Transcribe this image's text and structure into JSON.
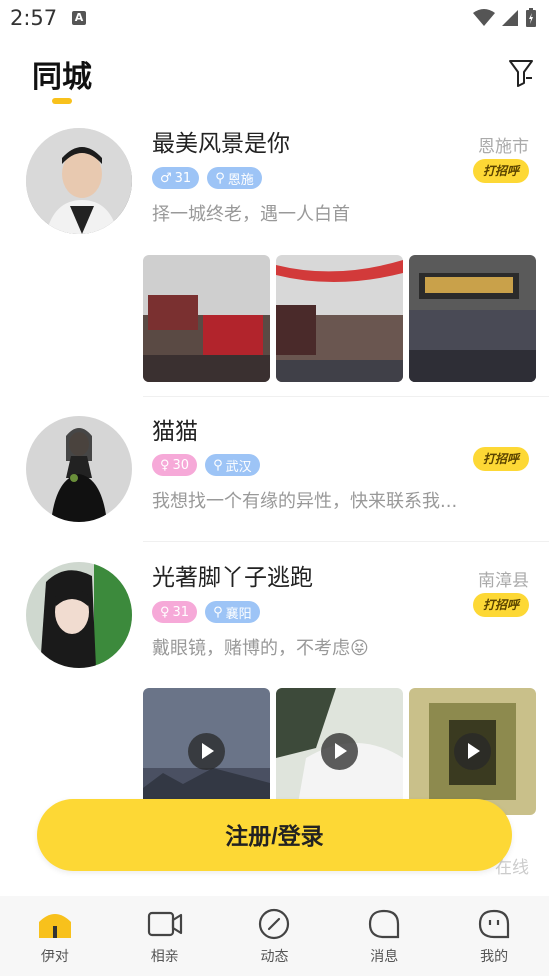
{
  "status_bar": {
    "time": "2:57",
    "notification_letter": "A"
  },
  "header": {
    "title": "同城"
  },
  "users": [
    {
      "name": "最美风景是你",
      "city": "恩施市",
      "greet": "打招呼",
      "gender": "male",
      "age": "31",
      "location": "恩施",
      "bio": "择一城终老，遇一人白首",
      "photo_count": 3
    },
    {
      "name": "猫猫",
      "city": "",
      "greet": "打招呼",
      "gender": "female",
      "age": "30",
      "location": "武汉",
      "bio": "我想找一个有缘的异性，快来联系我...",
      "photo_count": 0
    },
    {
      "name": "光著脚丫子逃跑",
      "city": "南漳县",
      "greet": "打招呼",
      "gender": "female",
      "age": "31",
      "location": "襄阳",
      "bio": "戴眼镜，赌博的，不考虑😝",
      "photo_count": 3,
      "video": true
    }
  ],
  "partial_next": {
    "status": "在线"
  },
  "login_button": "注册/登录",
  "tabs": [
    {
      "label": "伊对",
      "icon": "home-icon",
      "active": true
    },
    {
      "label": "相亲",
      "icon": "video-icon"
    },
    {
      "label": "动态",
      "icon": "compass-icon"
    },
    {
      "label": "消息",
      "icon": "message-icon"
    },
    {
      "label": "我的",
      "icon": "profile-icon"
    }
  ],
  "colors": {
    "accent": "#FDD835",
    "male_tag": "#9DC4F6",
    "female_tag": "#F6A9D8"
  }
}
